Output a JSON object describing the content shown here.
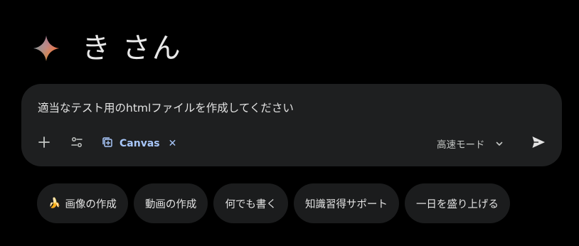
{
  "greeting": {
    "text": "き さん",
    "icon": "gemini-spark-icon"
  },
  "prompt": {
    "value": "適当なテスト用のhtmlファイルを作成してください"
  },
  "toolbar": {
    "add_icon": "plus-icon",
    "tools_icon": "tune-icon",
    "canvas_label": "Canvas",
    "canvas_close": "✕",
    "mode_label": "高速モード",
    "send_icon": "send-icon"
  },
  "suggestions": [
    {
      "emoji": "🍌",
      "label": "画像の作成"
    },
    {
      "emoji": "",
      "label": "動画の作成"
    },
    {
      "emoji": "",
      "label": "何でも書く"
    },
    {
      "emoji": "",
      "label": "知識習得サポート"
    },
    {
      "emoji": "",
      "label": "一日を盛り上げる"
    }
  ],
  "colors": {
    "background": "#000000",
    "prompt_box": "#1e1f20",
    "chip": "#1b1c1d",
    "accent": "#a8c7fa"
  }
}
